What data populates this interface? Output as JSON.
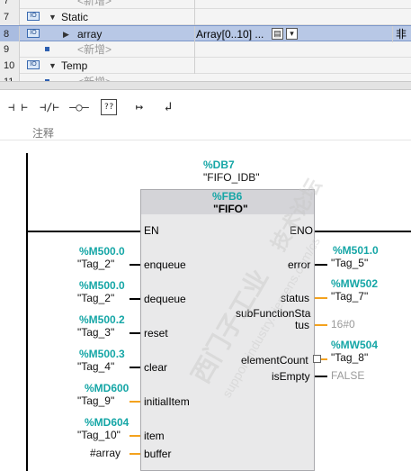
{
  "table": {
    "rows": [
      {
        "num": "7",
        "label": "<新增>",
        "kind": "placeholder"
      },
      {
        "num": "8",
        "label": "Static",
        "kind": "section"
      },
      {
        "num": "9",
        "label": "array",
        "kind": "selected",
        "type": "Array[0..10] ...",
        "col3": "非"
      },
      {
        "num": "9",
        "label": "<新增>",
        "kind": "placeholder"
      },
      {
        "num": "10",
        "label": "Temp",
        "kind": "section"
      },
      {
        "num": "11",
        "label": "<新增>",
        "kind": "placeholder"
      }
    ]
  },
  "toolbar": {
    "btn1": "⊣ ⊢",
    "btn2": "⊣/⊢",
    "btn3": "–○–",
    "btn4": "??",
    "btn5": "↦",
    "btn6": "↲"
  },
  "network": {
    "comment": "注释",
    "instance_db": "%DB7",
    "instance_name": "\"FIFO_IDB\"",
    "fb_number": "%FB6",
    "fb_name": "\"FIFO\"",
    "en": "EN",
    "eno": "ENO",
    "inputs": [
      {
        "addr": "%M500.0",
        "tag": "\"Tag_2\"",
        "pin": "enqueue"
      },
      {
        "addr": "%M500.0",
        "tag": "\"Tag_2\"",
        "pin": "dequeue"
      },
      {
        "addr": "%M500.2",
        "tag": "\"Tag_3\"",
        "pin": "reset"
      },
      {
        "addr": "%M500.3",
        "tag": "\"Tag_4\"",
        "pin": "clear"
      },
      {
        "addr": "%MD600",
        "tag": "\"Tag_9\"",
        "pin": "initialItem"
      },
      {
        "addr": "%MD604",
        "tag": "\"Tag_10\"",
        "pin": "item"
      },
      {
        "addr": "",
        "tag": "#array",
        "pin": "buffer"
      }
    ],
    "outputs": [
      {
        "addr": "%M501.0",
        "tag": "\"Tag_5\"",
        "pin": "error"
      },
      {
        "addr": "%MW502",
        "tag": "\"Tag_7\"",
        "pin": "status"
      },
      {
        "addr": "",
        "tag": "16#0",
        "pin_line1": "subFunctionSta",
        "pin_line2": "tus"
      },
      {
        "addr": "%MW504",
        "tag": "\"Tag_8\"",
        "pin": "elementCount"
      },
      {
        "addr": "",
        "tag": "FALSE",
        "pin": "isEmpty"
      }
    ]
  },
  "watermark": {
    "line1": "西门子工业",
    "line2": "support.industry.siemens.com/cs",
    "line3": "技术论坛"
  }
}
